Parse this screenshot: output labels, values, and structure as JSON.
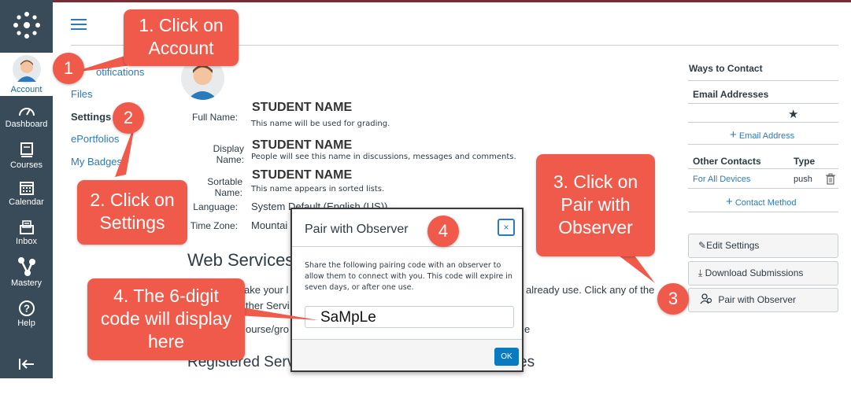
{
  "global_nav": {
    "items": [
      {
        "label": "Account",
        "icon": "account-avatar-icon"
      },
      {
        "label": "Dashboard",
        "icon": "dashboard-icon"
      },
      {
        "label": "Courses",
        "icon": "courses-icon"
      },
      {
        "label": "Calendar",
        "icon": "calendar-icon"
      },
      {
        "label": "Inbox",
        "icon": "inbox-icon"
      },
      {
        "label": "Mastery",
        "icon": "mastery-icon"
      },
      {
        "label": "Help",
        "icon": "help-icon"
      }
    ]
  },
  "section_nav": {
    "items": [
      {
        "label": "otifications"
      },
      {
        "label": "Files"
      },
      {
        "label": "Settings"
      },
      {
        "label": "ePortfolios"
      },
      {
        "label": "My Badges"
      }
    ]
  },
  "profile": {
    "full_name_label": "Full Name:",
    "full_name": "STUDENT NAME",
    "full_name_hint": "This name will be used for grading.",
    "display_name_label": "Display Name:",
    "display_name": "STUDENT NAME",
    "display_name_hint": "People will see this name in discussions, messages and comments.",
    "sortable_name_label": "Sortable Name:",
    "sortable_name": "STUDENT NAME",
    "sortable_name_hint": "This name appears in sorted lists.",
    "language_label": "Language:",
    "language": "System Default (English (US))",
    "timezone_label": "Time Zone:",
    "timezone": "Mountai"
  },
  "web_services": {
    "heading": "Web Services",
    "text_line1": "ake your l",
    "text_line1_right": "already use. Click any of the",
    "text_line2": "ther Servi",
    "text_line3": "ourse/gro",
    "text_line3_right": "e",
    "registered_heading": "Registered Serv",
    "registered_right": "es"
  },
  "ways_to_contact": {
    "title": "Ways to Contact",
    "email_heading": "Email Addresses",
    "star": "★",
    "add_email": "Email Address",
    "other_contacts_heading": "Other Contacts",
    "type_heading": "Type",
    "contact_row": {
      "name": "For All Devices",
      "type": "push"
    },
    "add_contact": "Contact Method"
  },
  "actions": {
    "edit_settings": "Edit Settings",
    "download_submissions": "Download Submissions",
    "pair_with_observer": "Pair with Observer"
  },
  "modal": {
    "title": "Pair with Observer",
    "close": "×",
    "description": "Share the following pairing code with an observer to allow them to connect with you. This code will expire in seven days, or after one use.",
    "code": "SaMpLe",
    "ok": "OK"
  },
  "callouts": {
    "step1": {
      "line1": "1. Click on",
      "line2": "Account",
      "badge": "1"
    },
    "step2": {
      "line1": "2. Click on",
      "line2": "Settings",
      "badge": "2"
    },
    "step3": {
      "line1": "3. Click on",
      "line2": "Pair with",
      "line3": "Observer",
      "badge": "3"
    },
    "step4": {
      "line1": "4. The 6-digit",
      "line2": "code will display",
      "line3": "here",
      "badge": "4"
    }
  },
  "colors": {
    "nav_bg": "#394b58",
    "link": "#2b7abc",
    "callout": "#f05a4b",
    "ok_button": "#0b7bc1"
  }
}
